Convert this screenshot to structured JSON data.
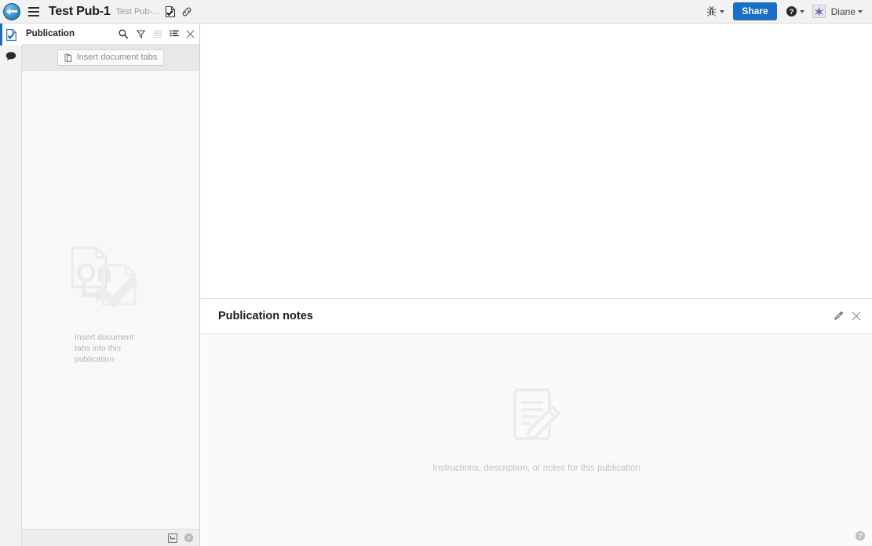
{
  "topbar": {
    "logo_icon": "app-logo-icon",
    "menu_icon": "hamburger-menu-icon",
    "title": "Test Pub-1",
    "subtitle": "Test Pub-...",
    "doc_check_icon": "document-check-icon",
    "link_icon": "link-icon",
    "bug_icon": "bug-icon",
    "share_label": "Share",
    "help_icon": "help-circle-icon",
    "avatar_icon": "user-avatar",
    "username": "Diane"
  },
  "rail": {
    "items": [
      {
        "name": "publication",
        "icon": "document-check-icon",
        "active": true
      },
      {
        "name": "comments",
        "icon": "comment-bubble-icon",
        "active": false
      }
    ]
  },
  "panel": {
    "title": "Publication",
    "header_icons": [
      {
        "name": "search-icon",
        "label": "Search"
      },
      {
        "name": "filter-icon",
        "label": "Filter"
      },
      {
        "name": "list-view-icon",
        "label": "List view"
      },
      {
        "name": "tree-view-icon",
        "label": "Tree view"
      },
      {
        "name": "close-icon",
        "label": "Close"
      }
    ],
    "insert_button_label": "Insert document tabs",
    "insert_button_icon": "paste-document-icon",
    "empty_text": "Insert document tabs into this publication",
    "empty_art_icon": "insert-document-tabs-watermark",
    "footer_icons": [
      {
        "name": "panel-layout-icon",
        "label": "Panel layout"
      },
      {
        "name": "help-circle-icon",
        "label": "Help"
      }
    ]
  },
  "notes": {
    "title": "Publication notes",
    "edit_icon": "pencil-edit-icon",
    "close_icon": "close-icon",
    "empty_text": "Instructions, description, or notes for this publication",
    "empty_art_icon": "notes-document-pencil-watermark"
  },
  "footer": {
    "help_icon": "help-circle-icon"
  },
  "colors": {
    "accent": "#1a6fc4",
    "topbar_bg": "#f2f2f2",
    "panel_bg": "#f8f8f8",
    "toolbar_bg": "#e8e8e8",
    "watermark": "#ececec",
    "muted_text": "#b4b4b4"
  }
}
